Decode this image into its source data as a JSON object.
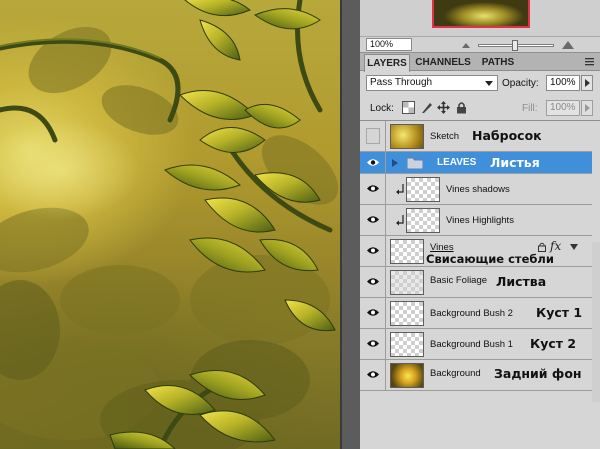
{
  "colors": {
    "selected_row": "#3f8fdb",
    "panel_bg": "#d6d6d6",
    "navigator_frame": "#e0304a",
    "leaf_light": "#d8cf3a",
    "leaf_dark": "#5d6c16"
  },
  "navigator": {
    "zoom_value": "100%"
  },
  "tabs": [
    {
      "label": "LAYERS",
      "active": true
    },
    {
      "label": "CHANNELS",
      "active": false
    },
    {
      "label": "PATHS",
      "active": false
    }
  ],
  "layers_panel": {
    "blend_mode": "Pass Through",
    "opacity_label": "Opacity:",
    "opacity_value": "100%",
    "lock_label": "Lock:",
    "fill_label": "Fill:",
    "fill_value": "100%",
    "icons": [
      "lock-transparent-icon",
      "lock-image-icon",
      "lock-position-icon",
      "lock-all-icon",
      "eye-icon",
      "folder-icon",
      "fx-icon",
      "link-icon",
      "clip-arrow-icon"
    ]
  },
  "layers": [
    {
      "name": "Sketch",
      "label_ru": "Набросок",
      "visible": false,
      "type": "sketch"
    },
    {
      "name": "LEAVES",
      "label_ru": "Листья",
      "visible": true,
      "type": "group",
      "selected": true
    },
    {
      "name": "Vines shadows",
      "label_ru": "",
      "visible": true,
      "type": "clipped"
    },
    {
      "name": "Vines Highlights",
      "label_ru": "",
      "visible": true,
      "type": "clipped"
    },
    {
      "name": "Vines",
      "label_ru": "Свисающие стебли",
      "visible": true,
      "type": "vines",
      "fx": "fx"
    },
    {
      "name": "Basic Foliage",
      "label_ru": "Листва",
      "visible": true,
      "type": "foliage"
    },
    {
      "name": "Background Bush 2",
      "label_ru": "Куст 1",
      "visible": true,
      "type": "transparent"
    },
    {
      "name": "Background Bush 1",
      "label_ru": "Куст 2",
      "visible": true,
      "type": "transparent"
    },
    {
      "name": "Background",
      "label_ru": "Задний фон",
      "visible": true,
      "type": "background"
    }
  ]
}
